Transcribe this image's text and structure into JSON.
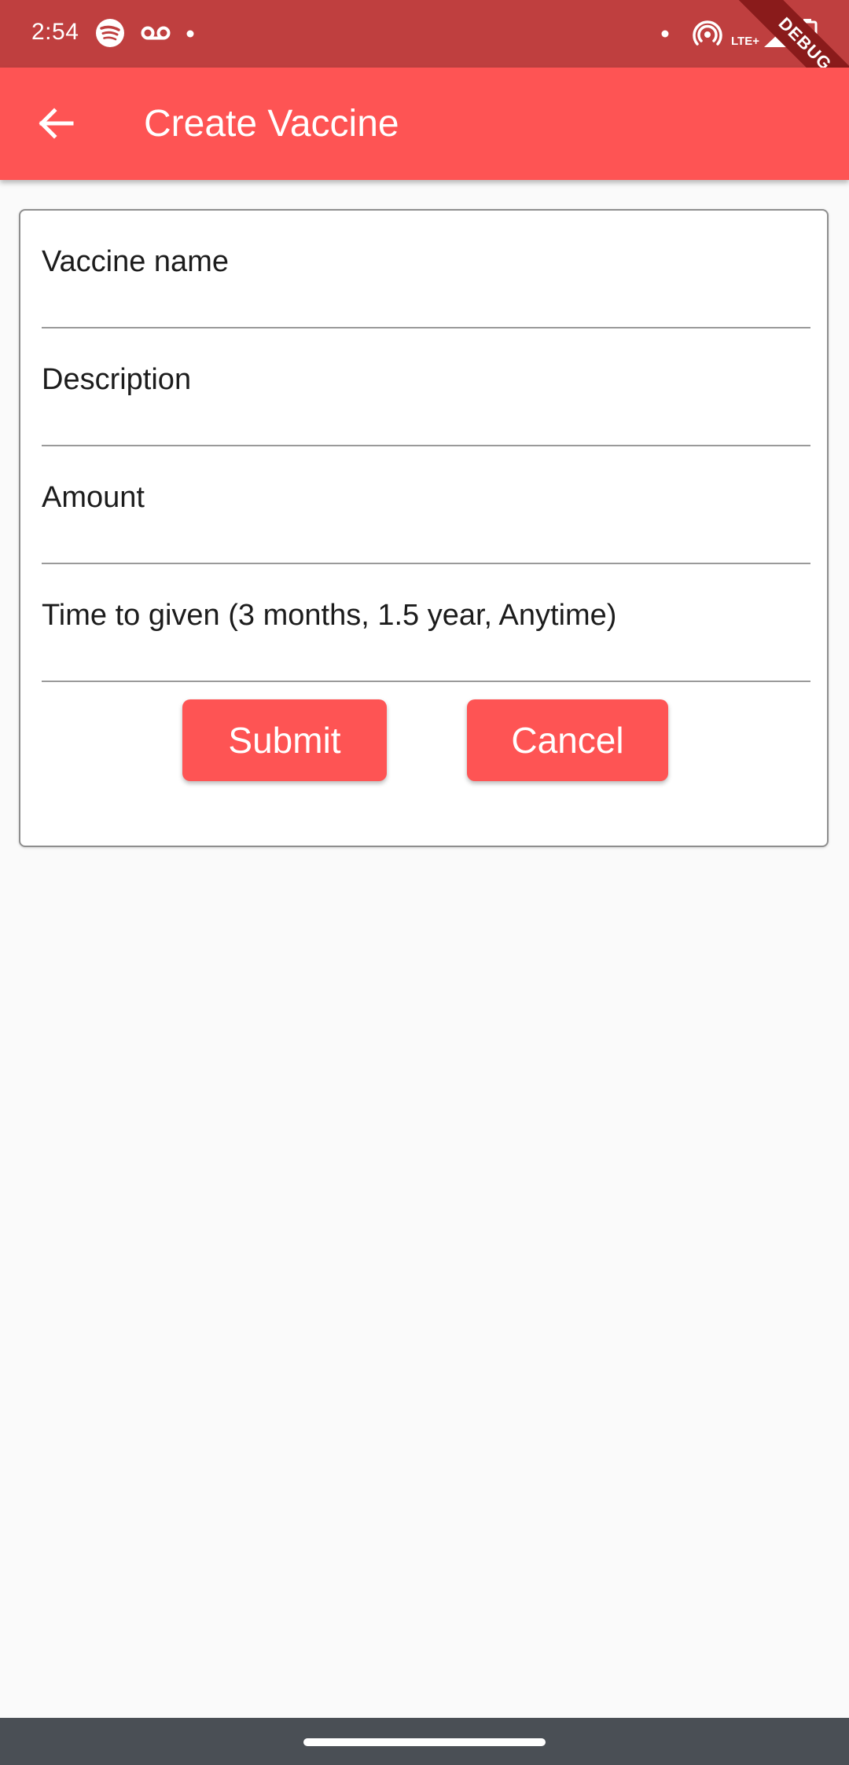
{
  "status_bar": {
    "time": "2:54",
    "network_label": "LTE+",
    "debug_label": "DEBUG"
  },
  "app_bar": {
    "title": "Create Vaccine"
  },
  "form": {
    "vaccine_name_placeholder": "Vaccine name",
    "description_placeholder": "Description",
    "amount_placeholder": "Amount",
    "time_placeholder": "Time to given (3 months, 1.5 year, Anytime)",
    "submit_label": "Submit",
    "cancel_label": "Cancel"
  },
  "colors": {
    "status_bar": "#bf3f3f",
    "accent": "#fe5454",
    "background": "#fafafa",
    "nav_bar": "#4a4f55"
  }
}
